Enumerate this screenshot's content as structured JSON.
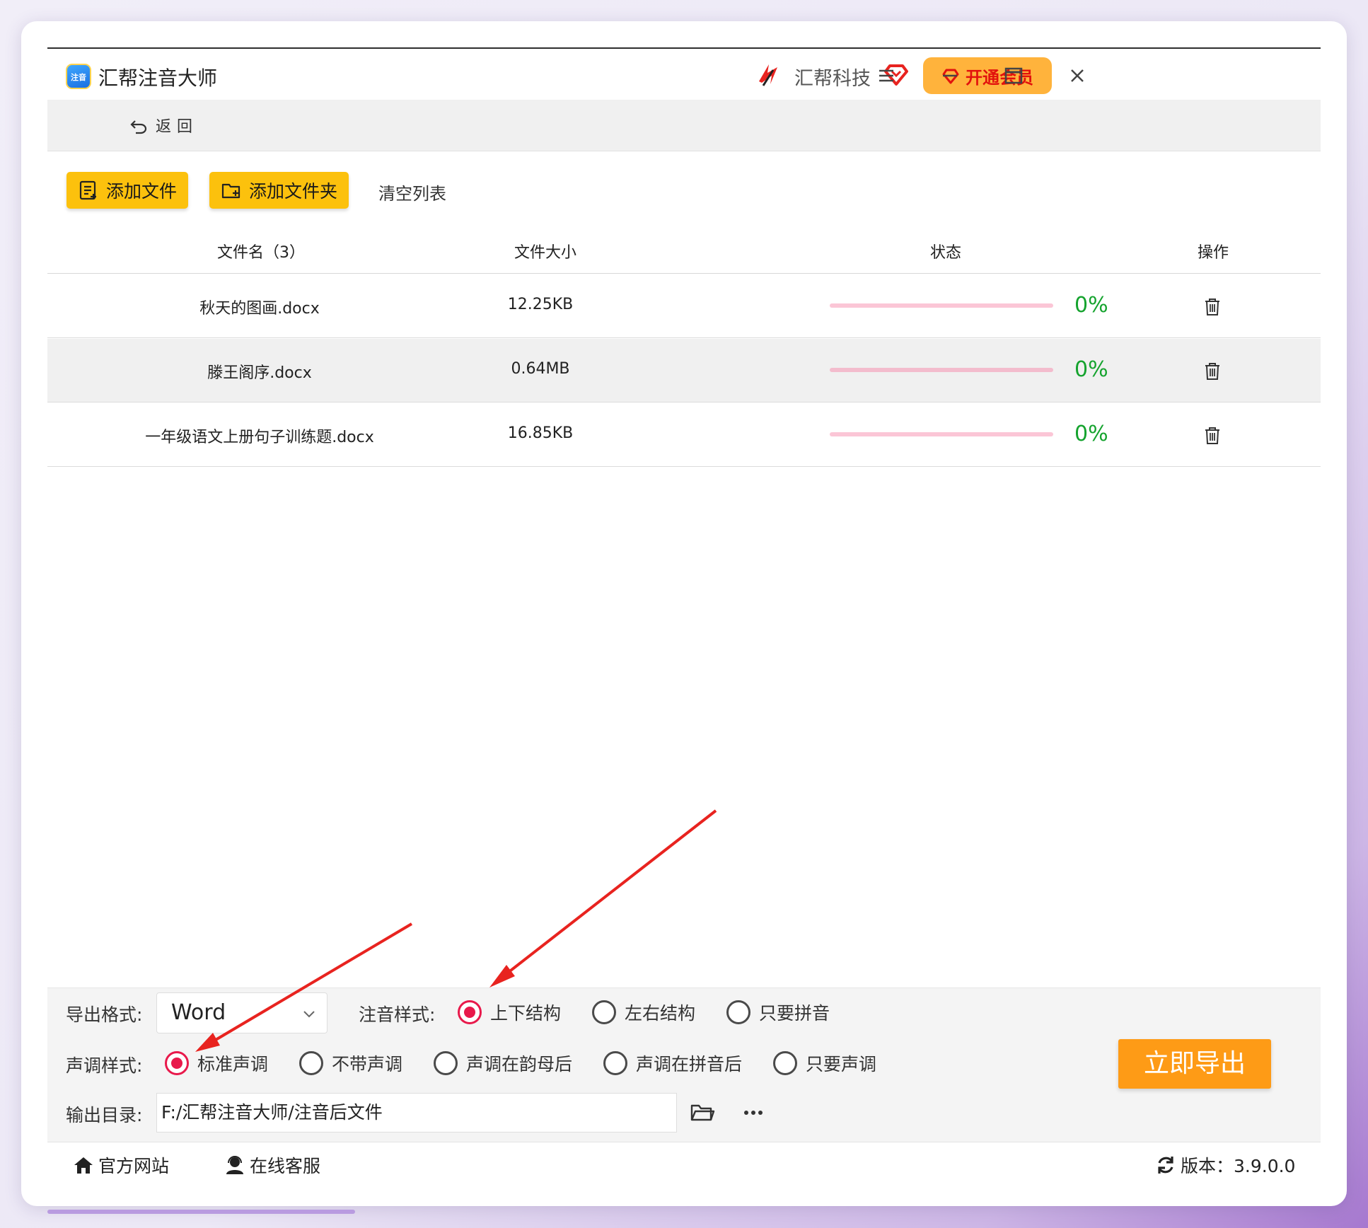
{
  "app": {
    "title": "汇帮注音大师",
    "logo_text": "注音",
    "brand": "汇帮科技",
    "vip_label": "开通会员"
  },
  "nav": {
    "back_label": "返回"
  },
  "toolbar": {
    "add_file": "添加文件",
    "add_folder": "添加文件夹",
    "clear_list": "清空列表"
  },
  "table": {
    "headers": {
      "name": "文件名（3）",
      "size": "文件大小",
      "status": "状态",
      "action": "操作"
    },
    "rows": [
      {
        "name": "秋天的图画.docx",
        "size": "12.25KB",
        "progress": "0%"
      },
      {
        "name": "滕王阁序.docx",
        "size": "0.64MB",
        "progress": "0%"
      },
      {
        "name": "一年级语文上册句子训练题.docx",
        "size": "16.85KB",
        "progress": "0%"
      }
    ]
  },
  "options": {
    "format_label": "导出格式:",
    "format_value": "Word",
    "phonetic_label": "注音样式:",
    "phonetic_options": [
      "上下结构",
      "左右结构",
      "只要拼音"
    ],
    "phonetic_selected": "上下结构",
    "tone_label": "声调样式:",
    "tone_options": [
      "标准声调",
      "不带声调",
      "声调在韵母后",
      "声调在拼音后",
      "只要声调"
    ],
    "tone_selected": "标准声调",
    "output_label": "输出目录:",
    "output_path": "F:/汇帮注音大师/注音后文件",
    "export_label": "立即导出"
  },
  "footer": {
    "website": "官方网站",
    "support": "在线客服",
    "version": "版本：3.9.0.0"
  },
  "colors": {
    "accent_yellow": "#fcc10d",
    "export_orange": "#fe9b16",
    "vip_bg": "#ffb33c",
    "vip_text": "#e2120d",
    "progress_pink": "#fbc6d6",
    "percent_green": "#15a32e",
    "radio_red": "#e8194b",
    "annotation_arrow": "#e8231f"
  }
}
